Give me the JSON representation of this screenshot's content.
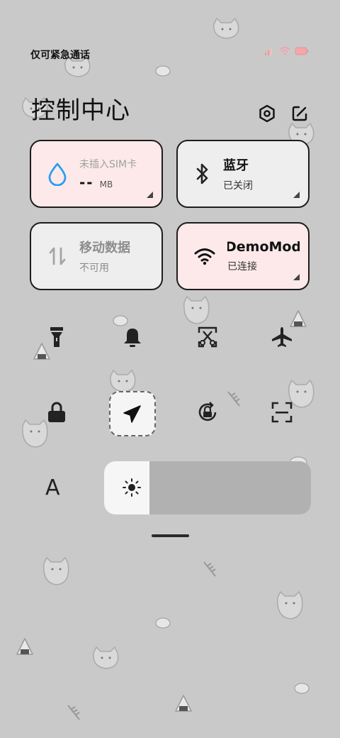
{
  "status_bar": {
    "text": "仅可紧急通话"
  },
  "header": {
    "title": "控制中心",
    "settings_icon": "gear-hexagon-icon",
    "edit_icon": "edit-icon"
  },
  "tiles": {
    "mobile_data_usage": {
      "label": "未插入SIM卡",
      "value": "--",
      "unit": "MB",
      "icon": "water-drop-icon"
    },
    "bluetooth": {
      "title": "蓝牙",
      "status": "已关闭",
      "icon": "bluetooth-icon"
    },
    "mobile_data": {
      "title": "移动数据",
      "status": "不可用",
      "icon": "data-arrows-icon"
    },
    "wifi": {
      "title": "DemoMode",
      "status": "已连接",
      "icon": "wifi-icon"
    }
  },
  "quick_buttons": [
    {
      "name": "flashlight",
      "icon": "flashlight-icon"
    },
    {
      "name": "silent",
      "icon": "bell-icon"
    },
    {
      "name": "screenshot",
      "icon": "scissors-screenshot-icon"
    },
    {
      "name": "airplane",
      "icon": "airplane-icon"
    },
    {
      "name": "lock-screen",
      "icon": "lock-icon"
    },
    {
      "name": "location",
      "icon": "location-arrow-icon"
    },
    {
      "name": "auto-rotate",
      "icon": "rotate-lock-icon"
    },
    {
      "name": "scan",
      "icon": "scan-icon"
    }
  ],
  "font_size": {
    "label": "A"
  },
  "brightness": {
    "level": 0.22,
    "icon": "sun-icon"
  },
  "colors": {
    "background": "#c9c9c9",
    "tile_pink": "#fde9e9",
    "tile_grey": "#eeeeee",
    "accent_blue": "#2a9df4"
  }
}
